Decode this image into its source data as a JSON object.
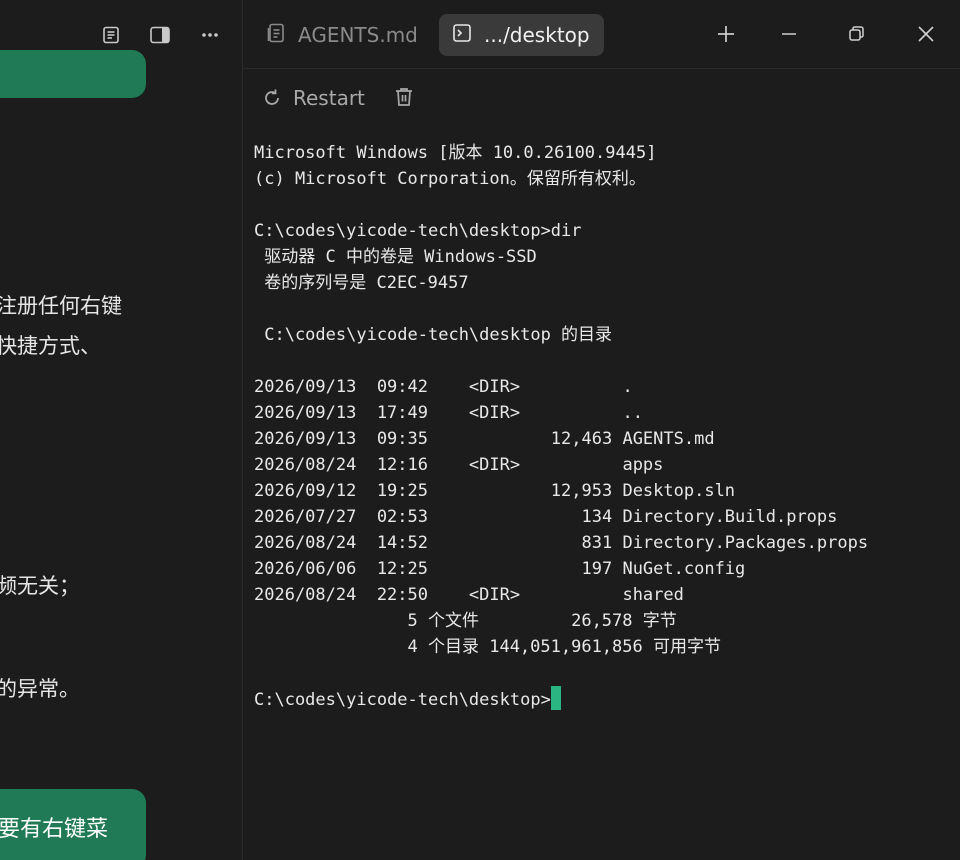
{
  "left_pane": {
    "toolbar_icons": [
      "outline-icon",
      "panel-toggle-icon",
      "more-icon"
    ],
    "bubble_top_text": "",
    "fragments": [
      "注册任何右键",
      "快捷方式、",
      "频无关；",
      "的异常。"
    ],
    "bubble_bottom_text": "要有右键菜"
  },
  "tabs": [
    {
      "label": "AGENTS.md",
      "icon": "document-icon",
      "active": false
    },
    {
      "label": ".../desktop",
      "icon": "terminal-icon",
      "active": true
    }
  ],
  "window_controls": [
    "new-tab-icon",
    "minimize-icon",
    "restore-icon",
    "close-icon"
  ],
  "actions": {
    "restart_label": "Restart",
    "delete_icon": "trash-icon"
  },
  "terminal": {
    "lines": [
      "Microsoft Windows [版本 10.0.26100.9445]",
      "(c) Microsoft Corporation。保留所有权利。",
      "",
      "C:\\codes\\yicode-tech\\desktop>dir",
      " 驱动器 C 中的卷是 Windows-SSD",
      " 卷的序列号是 C2EC-9457",
      "",
      " C:\\codes\\yicode-tech\\desktop 的目录",
      "",
      "2026/09/13  09:42    <DIR>          .",
      "2026/09/13  17:49    <DIR>          ..",
      "2026/09/13  09:35            12,463 AGENTS.md",
      "2026/08/24  12:16    <DIR>          apps",
      "2026/09/12  19:25            12,953 Desktop.sln",
      "2026/07/27  02:53               134 Directory.Build.props",
      "2026/08/24  14:52               831 Directory.Packages.props",
      "2026/06/06  12:25               197 NuGet.config",
      "2026/08/24  22:50    <DIR>          shared",
      "               5 个文件         26,578 字节",
      "               4 个目录 144,051,961,856 可用字节",
      ""
    ],
    "prompt": "C:\\codes\\yicode-tech\\desktop>"
  },
  "colors": {
    "background": "#1c1c1c",
    "tab_active": "#3a3a3a",
    "accent_green": "#1f7a55",
    "cursor": "#2bb583",
    "text": "#e8e8e8"
  }
}
